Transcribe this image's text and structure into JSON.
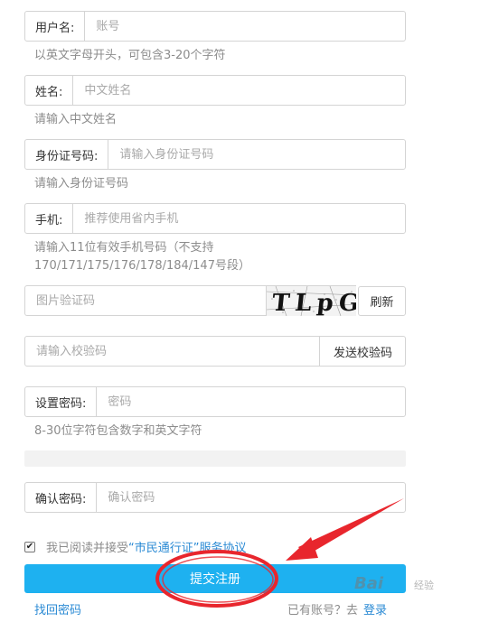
{
  "form": {
    "username": {
      "label": "用户名:",
      "placeholder": "账号",
      "hint": "以英文字母开头，可包含3-20个字符"
    },
    "name": {
      "label": "姓名:",
      "placeholder": "中文姓名",
      "hint": "请输入中文姓名"
    },
    "idcard": {
      "label": "身份证号码:",
      "placeholder": "请输入身份证号码",
      "hint": "请输入身份证号码"
    },
    "phone": {
      "label": "手机:",
      "placeholder": "推荐使用省内手机",
      "hint_line1": "请输入11位有效手机号码（不支持",
      "hint_line2": "170/171/175/176/178/184/147号段）"
    },
    "captcha": {
      "placeholder": "图片验证码",
      "image_text": "TLpG",
      "refresh_label": "刷新"
    },
    "sms": {
      "placeholder": "请输入校验码",
      "send_label": "发送校验码"
    },
    "password": {
      "label": "设置密码:",
      "placeholder": "密码",
      "hint": "8-30位字符包含数字和英文字符"
    },
    "confirm": {
      "label": "确认密码:",
      "placeholder": "确认密码"
    },
    "agreement": {
      "checked": true,
      "text": "我已阅读并接受",
      "link": "“市民通行证”服务协议"
    },
    "submit_label": "提交注册",
    "find_password": "找回密码",
    "have_account": "已有账号？去",
    "login": "登录"
  },
  "watermark": {
    "brand": "Bai",
    "sub": "经验"
  },
  "colors": {
    "accent": "#1eb1f0",
    "link": "#2a8ad4",
    "annotation": "#e8262d"
  }
}
